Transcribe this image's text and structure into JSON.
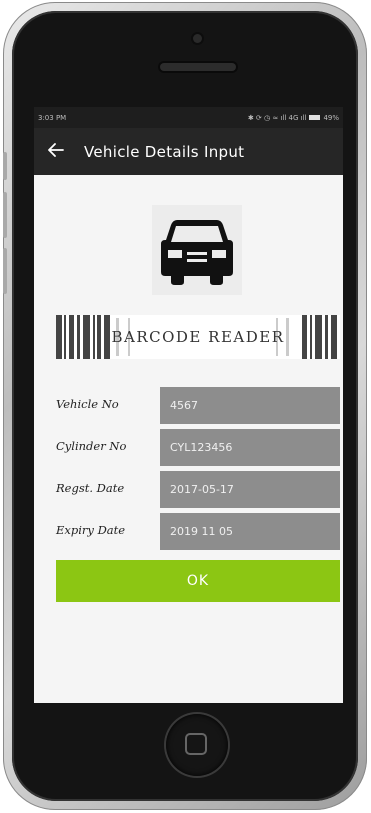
{
  "status_bar": {
    "time": "3:03 PM",
    "icons_text": "✱ ⟳ ◷ ≈ ıll 4G ıll",
    "battery_pct": "49%"
  },
  "app_bar": {
    "back_icon": "arrow-left-icon",
    "title": "Vehicle Details Input"
  },
  "hero": {
    "icon": "car-icon"
  },
  "barcode": {
    "label": "BARCODE READER"
  },
  "form": {
    "fields": [
      {
        "label": "Vehicle No",
        "value": "4567"
      },
      {
        "label": "Cylinder No",
        "value": "CYL123456"
      },
      {
        "label": "Regst. Date",
        "value": "2017-05-17"
      },
      {
        "label": "Expiry Date",
        "value": "2019 11 05"
      }
    ]
  },
  "ok_button": {
    "label": "OK"
  },
  "colors": {
    "app_bar": "#262626",
    "ok_button": "#8cc613",
    "input_bg": "#8d8d8d",
    "screen_bg": "#f5f5f5"
  }
}
